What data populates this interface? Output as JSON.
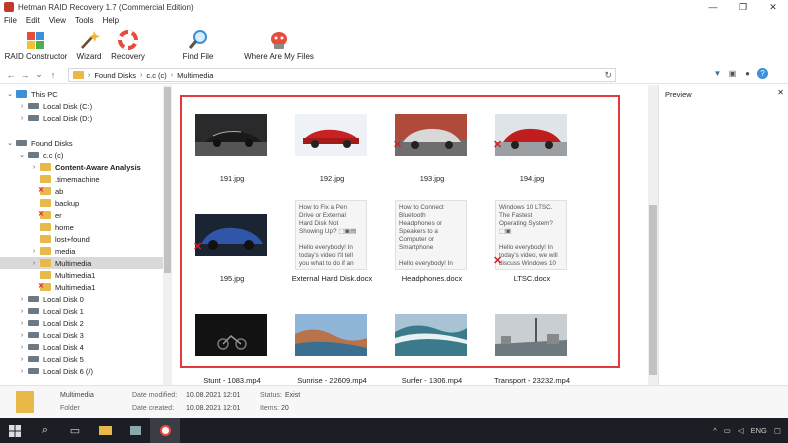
{
  "window": {
    "title": "Hetman RAID Recovery 1.7 (Commercial Edition)",
    "minimize": "—",
    "restore": "❐",
    "close": "✕"
  },
  "menu": [
    "File",
    "Edit",
    "View",
    "Tools",
    "Help"
  ],
  "ribbon": {
    "raid_constructor": "RAID Constructor",
    "wizard": "Wizard",
    "recovery": "Recovery",
    "find_file": "Find File",
    "where_are_my_files": "Where Are My Files"
  },
  "address": {
    "crumbs": [
      "Found Disks",
      "c.c (c)",
      "Multimedia"
    ]
  },
  "tree": {
    "this_pc": "This PC",
    "local_c": "Local Disk (C:)",
    "local_d": "Local Disk (D:)",
    "found_disks": "Found Disks",
    "cc": "c.c (c)",
    "content_aware": "Content-Aware Analysis",
    "timemachine": ".timemachine",
    "ab": "ab",
    "backup": "backup",
    "er": "er",
    "home": "home",
    "lostfound": "lost+found",
    "media": "media",
    "multimedia": "Multimedia",
    "multimedia1a": "Multimedia1",
    "multimedia1b": "Multimedia1",
    "ld0": "Local Disk 0",
    "ld1": "Local Disk 1",
    "ld2": "Local Disk 2",
    "ld3": "Local Disk 3",
    "ld4": "Local Disk 4",
    "ld5": "Local Disk 5",
    "ld6": "Local Disk 6 (/)"
  },
  "files": {
    "f191": "191.jpg",
    "f192": "192.jpg",
    "f193": "193.jpg",
    "f194": "194.jpg",
    "f195": "195.jpg",
    "external": "External Hard Disk.docx",
    "headphones": "Headphones.docx",
    "ltsc": "LTSC.docx",
    "stunt": "Stunt - 1083.mp4",
    "sunrise": "Sunrise - 22609.mp4",
    "surfer": "Surfer - 1306.mp4",
    "transport": "Transport - 23232.mp4"
  },
  "doc_previews": {
    "external": [
      "How to Fix a Pen",
      "Drive or External",
      "Hard Disk Not",
      "Showing Up? ⬚▣▤",
      "",
      "Hello everybody! In",
      "today's video I'll tell",
      "you what to do if an"
    ],
    "headphones": [
      "How to Connect",
      "Bluetooth",
      "Headphones or",
      "Speakers to a",
      "Computer or",
      "Smartphone",
      "",
      "Hello everybody! In"
    ],
    "ltsc": [
      "Windows 10 LTSC.",
      "The Fastest",
      "Operating System?",
      "⬚▣",
      "",
      "Hello everybody! In",
      "today's video, we will",
      "discuss Windows 10"
    ]
  },
  "preview": {
    "title": "Preview",
    "close": "✕"
  },
  "status": {
    "name": "Multimedia",
    "type": "Folder",
    "modified_label": "Date modified:",
    "modified_value": "10.08.2021 12:01",
    "created_label": "Date created:",
    "created_value": "10.08.2021 12:01",
    "status_label": "Status:",
    "status_value": "Exist",
    "items_label": "Items:",
    "items_value": "20"
  },
  "taskbar": {
    "lang": "ENG",
    "tray_up": "^",
    "net": "▭",
    "vol": "◁",
    "notif": "▢"
  },
  "colors": {
    "highlight": "#e03a3a",
    "folder": "#e8b949",
    "deleted": "#d42020"
  }
}
